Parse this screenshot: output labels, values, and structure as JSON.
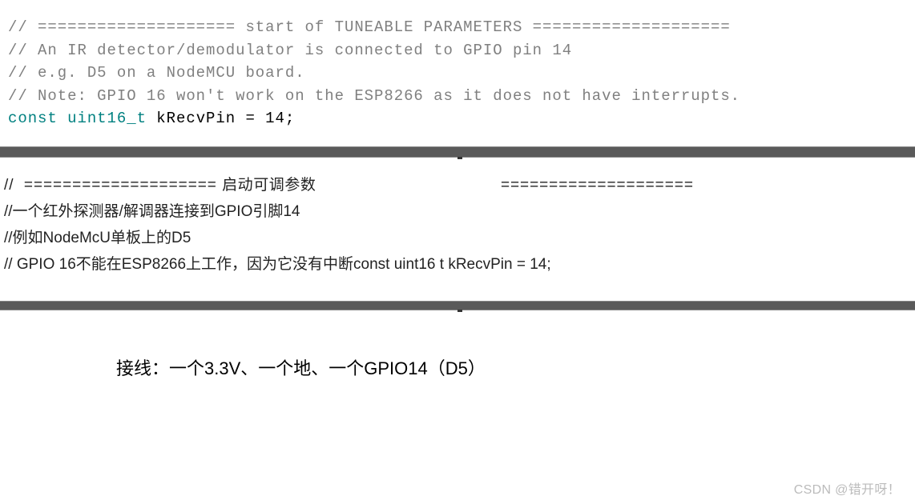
{
  "code": {
    "line1": "// ==================== start of TUNEABLE PARAMETERS ====================",
    "line2": "// An IR detector/demodulator is connected to GPIO pin 14",
    "line3": "// e.g. D5 on a NodeMCU board.",
    "line4": "// Note: GPIO 16 won't work on the ESP8266 as it does not have interrupts.",
    "type_kw": "const uint16_t",
    "var_name": " kRecvPin = 14;"
  },
  "translation": {
    "prefix1": "//  ==================== ",
    "text1": "启动可调参数",
    "suffix1": "                                     ====================",
    "line2": "//一个红外探测器/解调器连接到GPIO引脚14",
    "line3": "//例如NodeMcU单板上的D5",
    "line4": "// GPIO 16不能在ESP8266上工作，因为它没有中断const uint16 t kRecvPin = 14;"
  },
  "wiring": "接线：一个3.3V、一个地、一个GPIO14（D5）",
  "watermark": "CSDN @错开呀！"
}
